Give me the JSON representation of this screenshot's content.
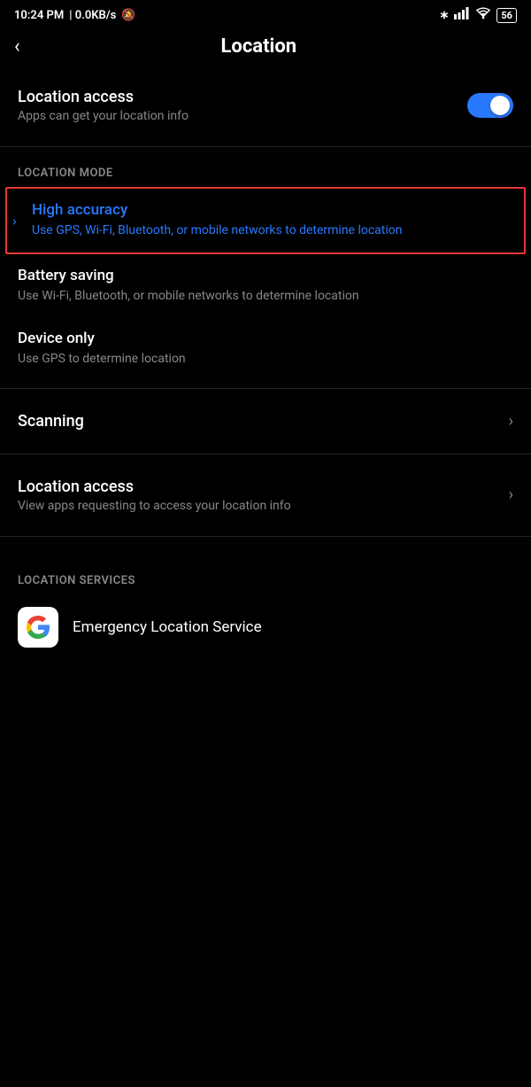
{
  "statusBar": {
    "time": "10:24 PM",
    "network": "0.0KB/s",
    "mute_icon": "🔕",
    "battery": "56"
  },
  "header": {
    "back_label": "‹",
    "title": "Location"
  },
  "locationAccess": {
    "label": "Location access",
    "subtitle": "Apps can get your location info",
    "toggle_on": true
  },
  "locationMode": {
    "section_label": "LOCATION MODE",
    "items": [
      {
        "title": "High accuracy",
        "subtitle": "Use GPS, Wi-Fi, Bluetooth, or mobile networks to determine location",
        "highlighted": true,
        "blue": true
      },
      {
        "title": "Battery saving",
        "subtitle": "Use Wi-Fi, Bluetooth, or mobile networks to determine location",
        "highlighted": false,
        "blue": false
      },
      {
        "title": "Device only",
        "subtitle": "Use GPS to determine location",
        "highlighted": false,
        "blue": false
      }
    ]
  },
  "menuItems": [
    {
      "label": "Scanning",
      "subtitle": ""
    },
    {
      "label": "Location access",
      "subtitle": "View apps requesting to access your location info"
    }
  ],
  "locationServices": {
    "section_label": "LOCATION SERVICES",
    "items": [
      {
        "icon": "G",
        "label": "Emergency Location Service"
      }
    ]
  }
}
